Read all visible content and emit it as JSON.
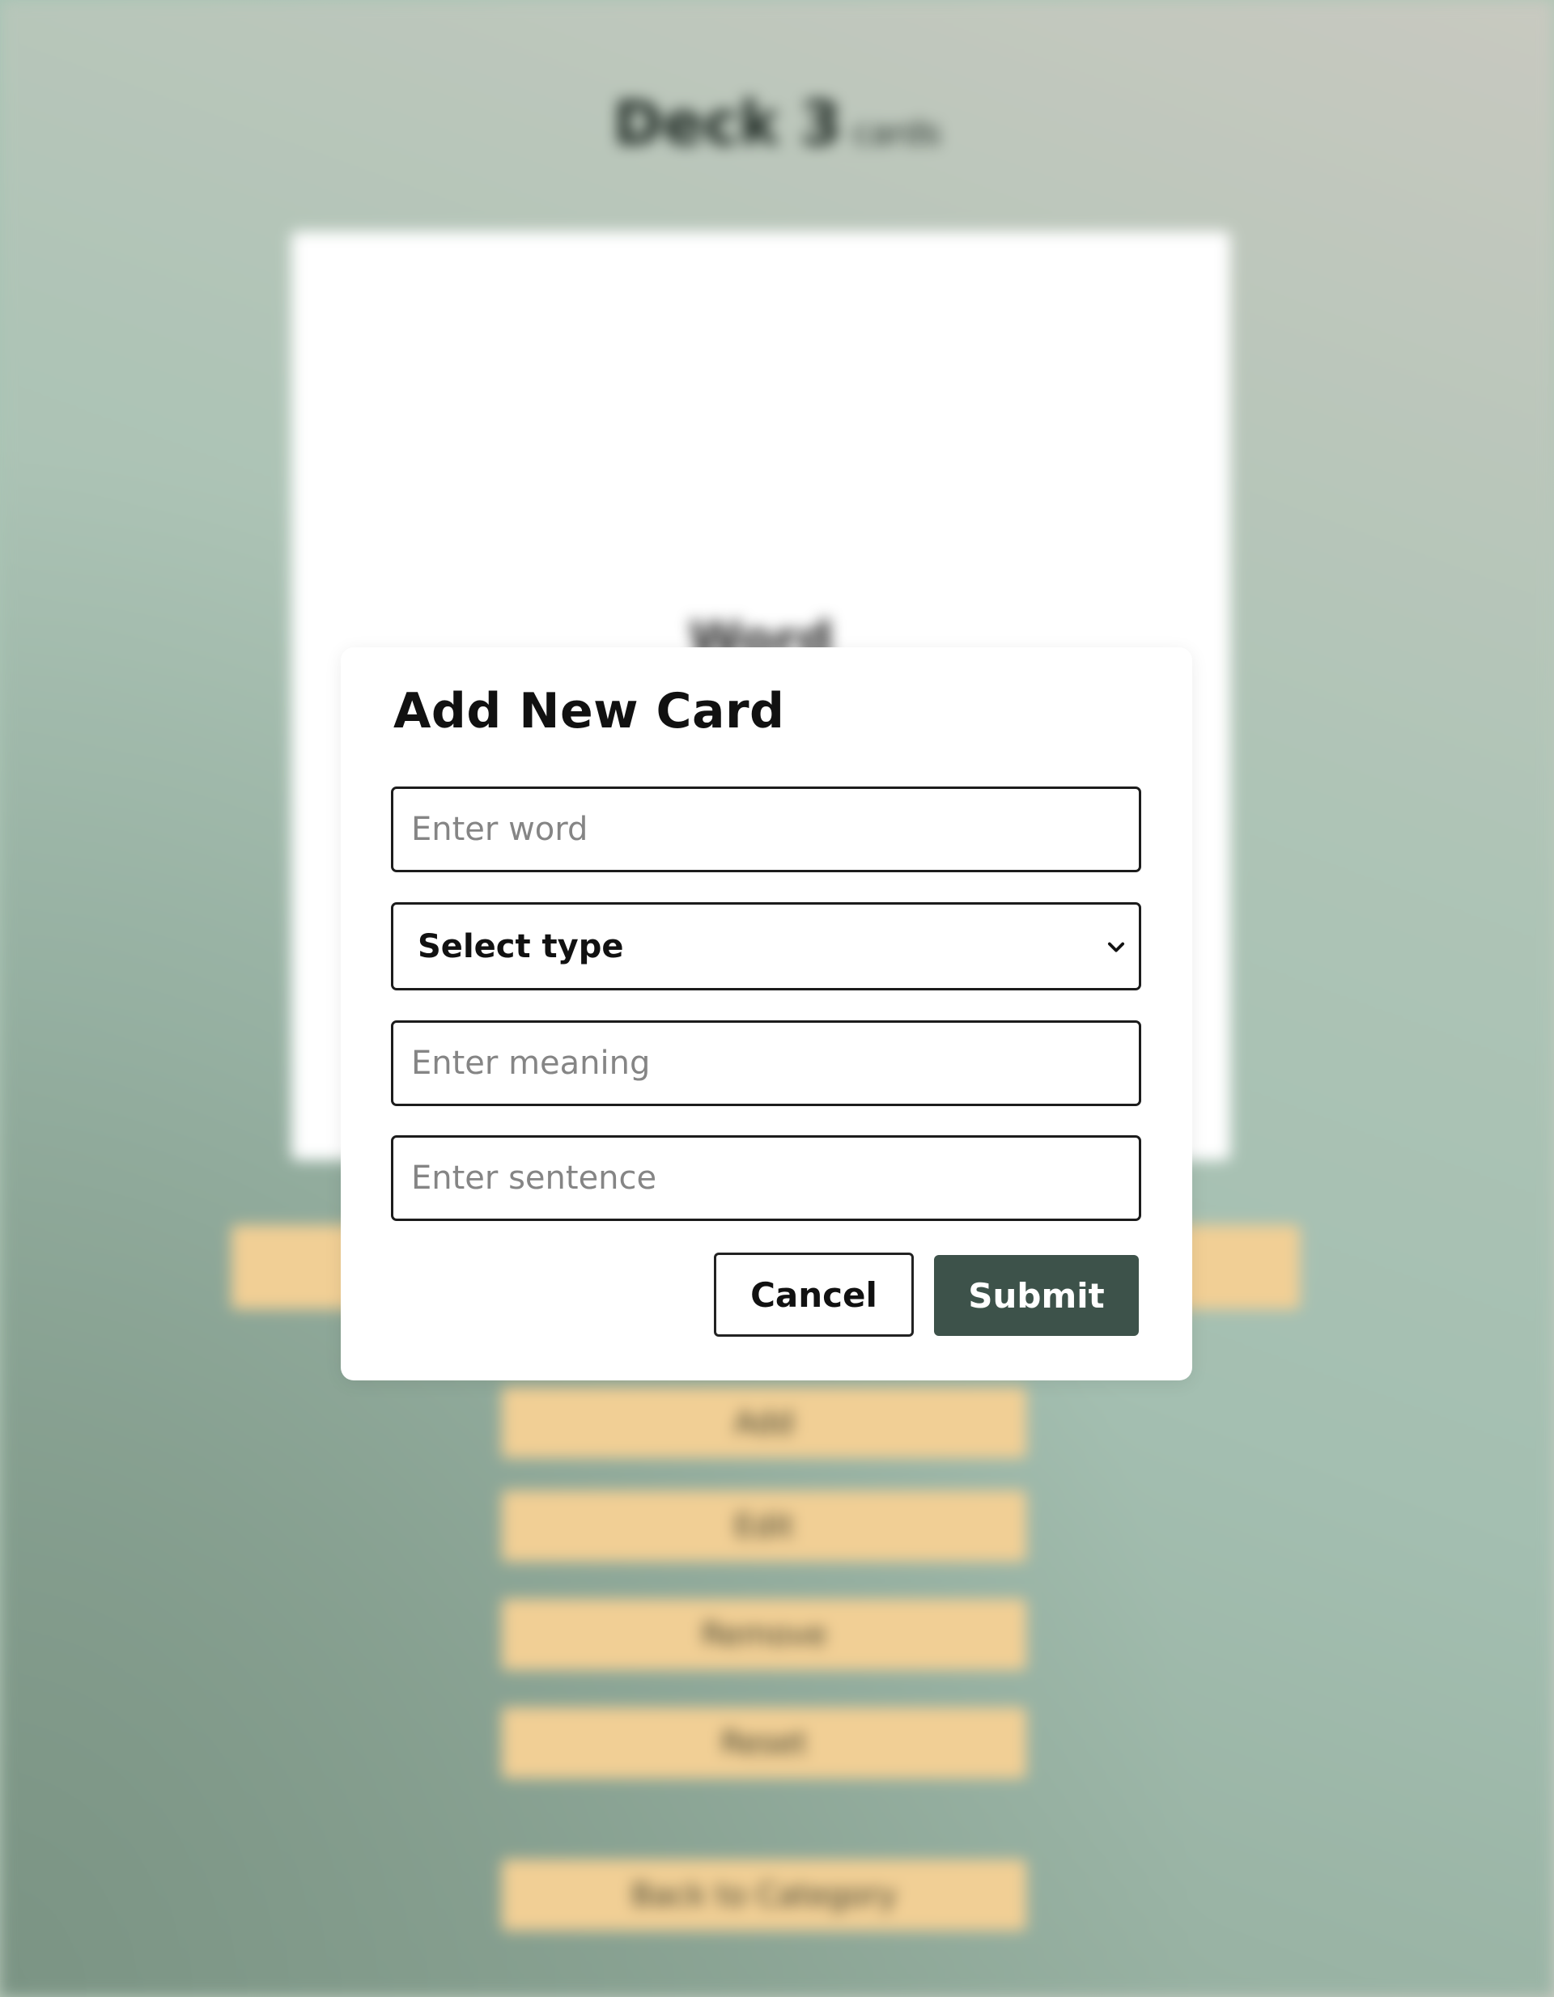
{
  "background": {
    "deck_title": "Deck 3",
    "deck_suffix": "cards",
    "card_word": "Word",
    "action_buttons": [
      "Add",
      "Edit",
      "Remove",
      "Reset"
    ],
    "back_button": "Back to Category"
  },
  "modal": {
    "title": "Add New Card",
    "word_placeholder": "Enter word",
    "type_select": {
      "selected": "Select type"
    },
    "meaning_placeholder": "Enter meaning",
    "sentence_placeholder": "Enter sentence",
    "cancel_label": "Cancel",
    "submit_label": "Submit"
  },
  "colors": {
    "submit_bg": "#3d524a",
    "accent_button": "#f1cf95",
    "background": "#a6c4b4"
  }
}
